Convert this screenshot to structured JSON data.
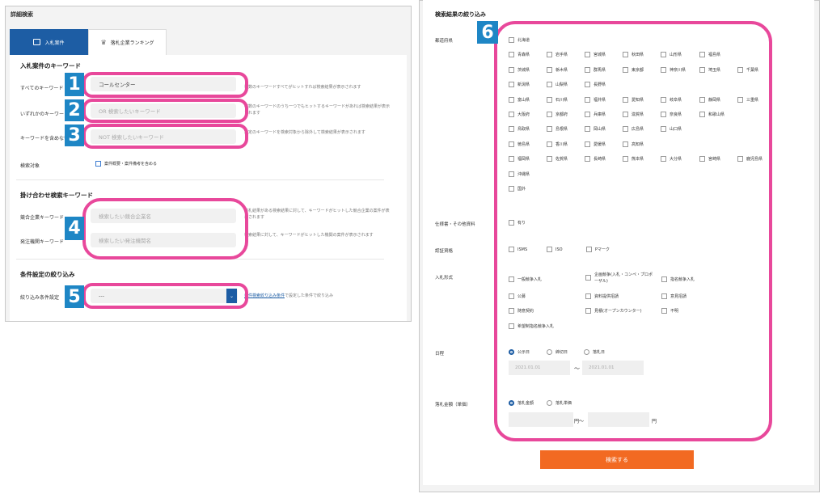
{
  "left": {
    "title": "詳細検索",
    "tabs": [
      {
        "label": "入札案件"
      },
      {
        "label": "落札企業ランキング"
      }
    ],
    "keyword_section": "入札案件のキーワード",
    "rows": [
      {
        "label": "すべてのキーワード",
        "value": "コールセンター",
        "help": "複数のキーワードすべてがヒットすれば検索結果が表示されます"
      },
      {
        "label": "いずれかのキーワード",
        "placeholder": "OR 検索したいキーワード",
        "help": "複数のキーワードのうち一つでもヒットするキーワードがあれば検索結果が表示されます"
      },
      {
        "label": "キーワードを含めない",
        "placeholder": "NOT 検索したいキーワード",
        "help": "指定のキーワードを検索対象から除外して検索結果が表示されます"
      }
    ],
    "target_label": "検索対象",
    "target_option": "案件概要・案件備考を含める",
    "cross_section": "掛け合わせ検索キーワード",
    "cross_rows": [
      {
        "label": "競合企業キーワード",
        "placeholder": "検索したい競合企業名",
        "help": "落札結果がある検索結果に対して、キーワードがヒットした競合企業の案件が表示されます"
      },
      {
        "label": "発注機関キーワード",
        "placeholder": "検索したい発注機関名",
        "help": "検索結果に対して、キーワードがヒットした機関の案件が表示されます"
      }
    ],
    "condition_section": "条件設定の絞り込み",
    "condition_label": "絞り込み条件設定",
    "condition_value": "---",
    "condition_link": "条件検索絞り込み条件",
    "condition_help": "で設定した条件で絞り込み",
    "badges": [
      "1",
      "2",
      "3",
      "4",
      "5"
    ]
  },
  "right": {
    "title": "検索結果の絞り込み",
    "badge": "6",
    "pref_label": "都道府県",
    "pref_rows": [
      [
        "北海道"
      ],
      [
        "青森県",
        "岩手県",
        "宮城県",
        "秋田県",
        "山形県",
        "福島県"
      ],
      [
        "茨城県",
        "栃木県",
        "群馬県",
        "東京都",
        "神奈川県",
        "埼玉県",
        "千葉県"
      ],
      [
        "新潟県",
        "山梨県",
        "長野県"
      ],
      [
        "富山県",
        "石川県",
        "福井県",
        "愛知県",
        "岐阜県",
        "静岡県",
        "三重県"
      ],
      [
        "大阪府",
        "京都府",
        "兵庫県",
        "滋賀県",
        "奈良県",
        "和歌山県"
      ],
      [
        "鳥取県",
        "島根県",
        "岡山県",
        "広島県",
        "山口県"
      ],
      [
        "徳島県",
        "香川県",
        "愛媛県",
        "高知県"
      ],
      [
        "福岡県",
        "佐賀県",
        "長崎県",
        "熊本県",
        "大分県",
        "宮崎県",
        "鹿児島県"
      ],
      [
        "沖縄県"
      ],
      [
        "国外"
      ]
    ],
    "spec_label": "仕様書・その他資料",
    "spec_option": "有り",
    "cert_label": "認証資格",
    "cert_options": [
      "ISMS",
      "ISO",
      "Pマーク"
    ],
    "bid_label": "入札形式",
    "bid_options": [
      "一般競争入札",
      "企画競争(入札・コンペ・プロポーザル)",
      "指名競争入札",
      "公募",
      "資料提供招請",
      "意見招請",
      "随意契約",
      "見積(オープンカウンター)",
      "不明",
      "希望制指名競争入札"
    ],
    "date_label": "日程",
    "date_options": [
      "公示日",
      "締切日",
      "落札日"
    ],
    "date_from": "2021.01.01",
    "date_sep": "〜",
    "date_to": "2021.01.01",
    "amount_label": "落札金額（単価）",
    "amount_options": [
      "落札金額",
      "落札単価"
    ],
    "amount_unit1": "円〜",
    "amount_unit2": "円",
    "search_button": "検索する"
  },
  "colors": {
    "accent": "#1d5da4",
    "highlight": "#e8489b",
    "badge": "#1e86c5",
    "button": "#f26a22"
  }
}
